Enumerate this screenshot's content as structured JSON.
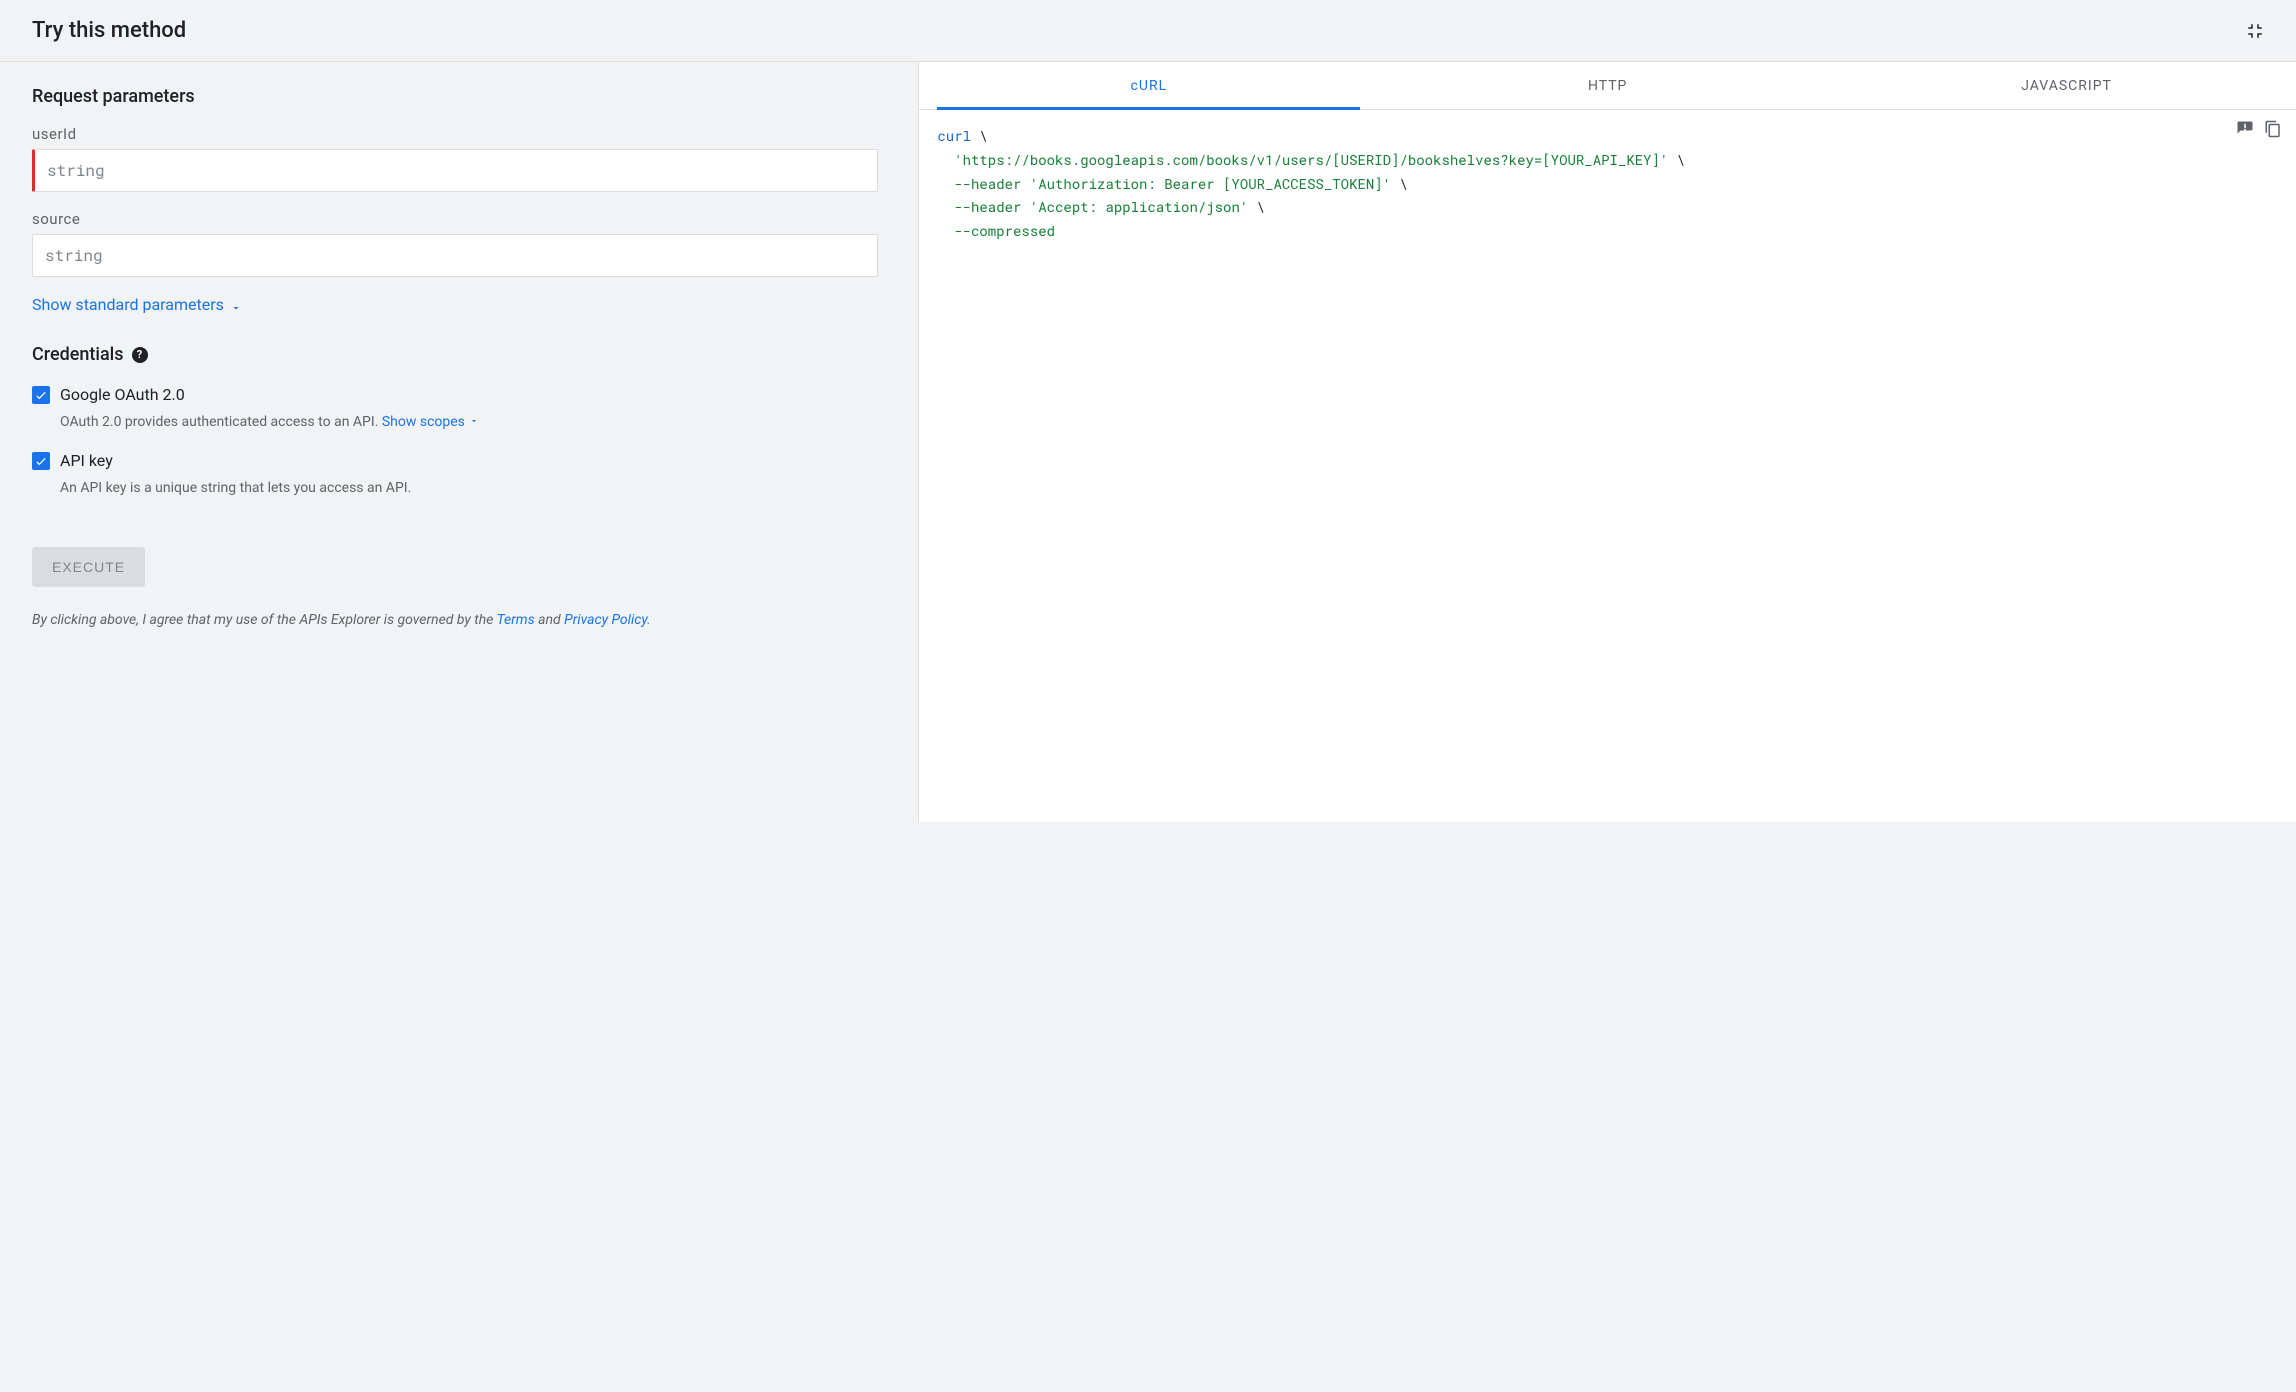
{
  "header": {
    "title": "Try this method"
  },
  "params": {
    "section_title": "Request parameters",
    "fields": [
      {
        "label": "userId",
        "placeholder": "string",
        "required": true
      },
      {
        "label": "source",
        "placeholder": "string",
        "required": false
      }
    ],
    "show_standard": "Show standard parameters"
  },
  "credentials": {
    "title": "Credentials",
    "items": [
      {
        "label": "Google OAuth 2.0",
        "checked": true,
        "desc_prefix": "OAuth 2.0 provides authenticated access to an API. ",
        "link": "Show scopes"
      },
      {
        "label": "API key",
        "checked": true,
        "desc_prefix": "An API key is a unique string that lets you access an API.",
        "link": ""
      }
    ]
  },
  "execute": {
    "label": "EXECUTE"
  },
  "disclaimer": {
    "prefix": "By clicking above, I agree that my use of the APIs Explorer is governed by the ",
    "terms": "Terms",
    "and": " and ",
    "privacy": "Privacy Policy",
    "suffix": "."
  },
  "tabs": {
    "items": [
      "cURL",
      "HTTP",
      "JAVASCRIPT"
    ],
    "active": 0
  },
  "code": {
    "curl_kw": "curl",
    "bs": " \\",
    "line2_url": "'https://books.googleapis.com/books/v1/users/[USERID]/bookshelves?key=[YOUR_API_KEY]'",
    "line3_flag": "--header",
    "line3_val": "'Authorization: Bearer [YOUR_ACCESS_TOKEN]'",
    "line4_flag": "--header",
    "line4_val": "'Accept: application/json'",
    "line5_flag": "--compressed"
  }
}
